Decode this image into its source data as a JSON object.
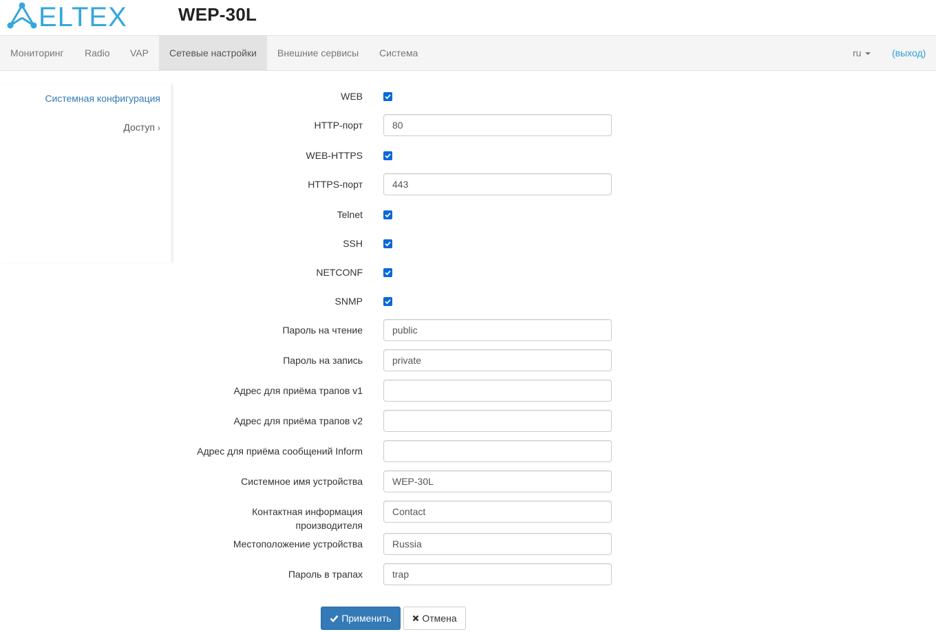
{
  "header": {
    "brand": "ELTEX",
    "device_title": "WEP-30L"
  },
  "nav": {
    "items": [
      {
        "label": "Мониторинг"
      },
      {
        "label": "Radio"
      },
      {
        "label": "VAP"
      },
      {
        "label": "Сетевые настройки",
        "active": true
      },
      {
        "label": "Внешние сервисы"
      },
      {
        "label": "Система"
      }
    ],
    "lang": "ru",
    "logout": "(выход)"
  },
  "sidebar": {
    "items": [
      {
        "label": "Системная конфигурация",
        "active": true
      },
      {
        "label": "Доступ"
      }
    ]
  },
  "form": {
    "web": {
      "label": "WEB",
      "checked": true
    },
    "http_port": {
      "label": "HTTP-порт",
      "value": "80"
    },
    "web_https": {
      "label": "WEB-HTTPS",
      "checked": true
    },
    "https_port": {
      "label": "HTTPS-порт",
      "value": "443"
    },
    "telnet": {
      "label": "Telnet",
      "checked": true
    },
    "ssh": {
      "label": "SSH",
      "checked": true
    },
    "netconf": {
      "label": "NETCONF",
      "checked": true
    },
    "snmp": {
      "label": "SNMP",
      "checked": true
    },
    "read_password": {
      "label": "Пароль на чтение",
      "value": "public"
    },
    "write_password": {
      "label": "Пароль на запись",
      "value": "private"
    },
    "trap_v1": {
      "label": "Адрес для приёма трапов v1",
      "value": ""
    },
    "trap_v2": {
      "label": "Адрес для приёма трапов v2",
      "value": ""
    },
    "inform": {
      "label": "Адрес для приёма сообщений Inform",
      "value": ""
    },
    "sys_name": {
      "label": "Системное имя устройства",
      "value": "WEP-30L"
    },
    "contact": {
      "label": "Контактная информация производителя",
      "value": "Contact"
    },
    "location": {
      "label": "Местоположение устройства",
      "value": "Russia"
    },
    "trap_password": {
      "label": "Пароль в трапах",
      "value": "trap"
    }
  },
  "buttons": {
    "apply": "Применить",
    "cancel": "Отмена"
  },
  "colors": {
    "brand": "#35a7dd",
    "primary": "#337ab7",
    "link": "#2aa0d8"
  }
}
